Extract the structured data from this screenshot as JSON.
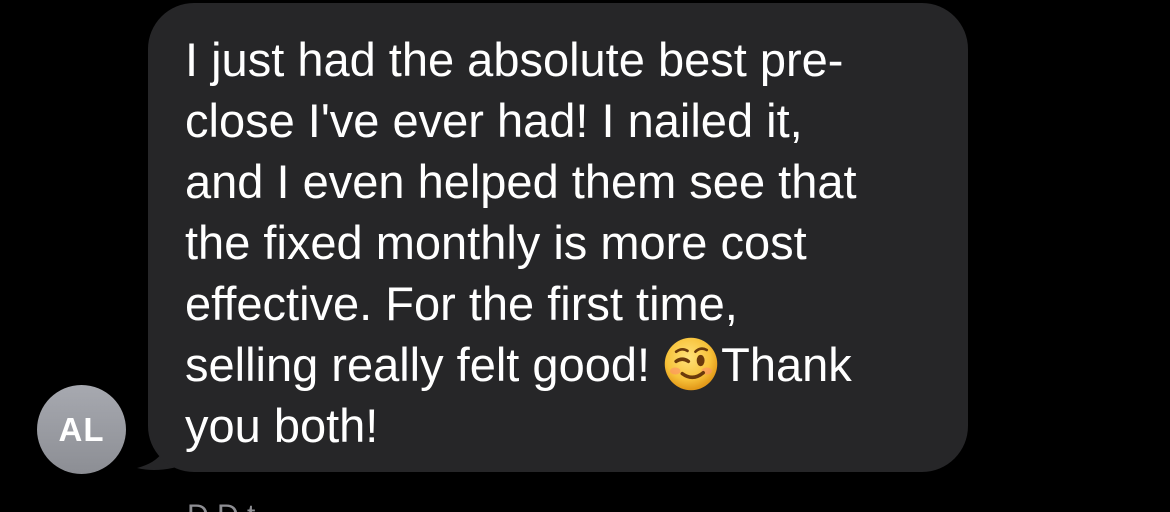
{
  "message": {
    "avatar_initials": "AL",
    "text_before_emoji": "I just had the absolute best pre-\nclose I've ever had! I nailed it,\nand I even helped them see that\nthe fixed monthly is more cost\neffective. For the first time,\nselling really felt good! ",
    "emoji": "winking-face-emoji",
    "text_after_emoji": "Thank\nyou both!",
    "sender_name_partial": "D       D  t"
  },
  "colors": {
    "background": "#000000",
    "bubble": "#262628",
    "text": "#ffffff",
    "avatar": "#9a9ca2",
    "emoji_face": "#f7c23a"
  }
}
